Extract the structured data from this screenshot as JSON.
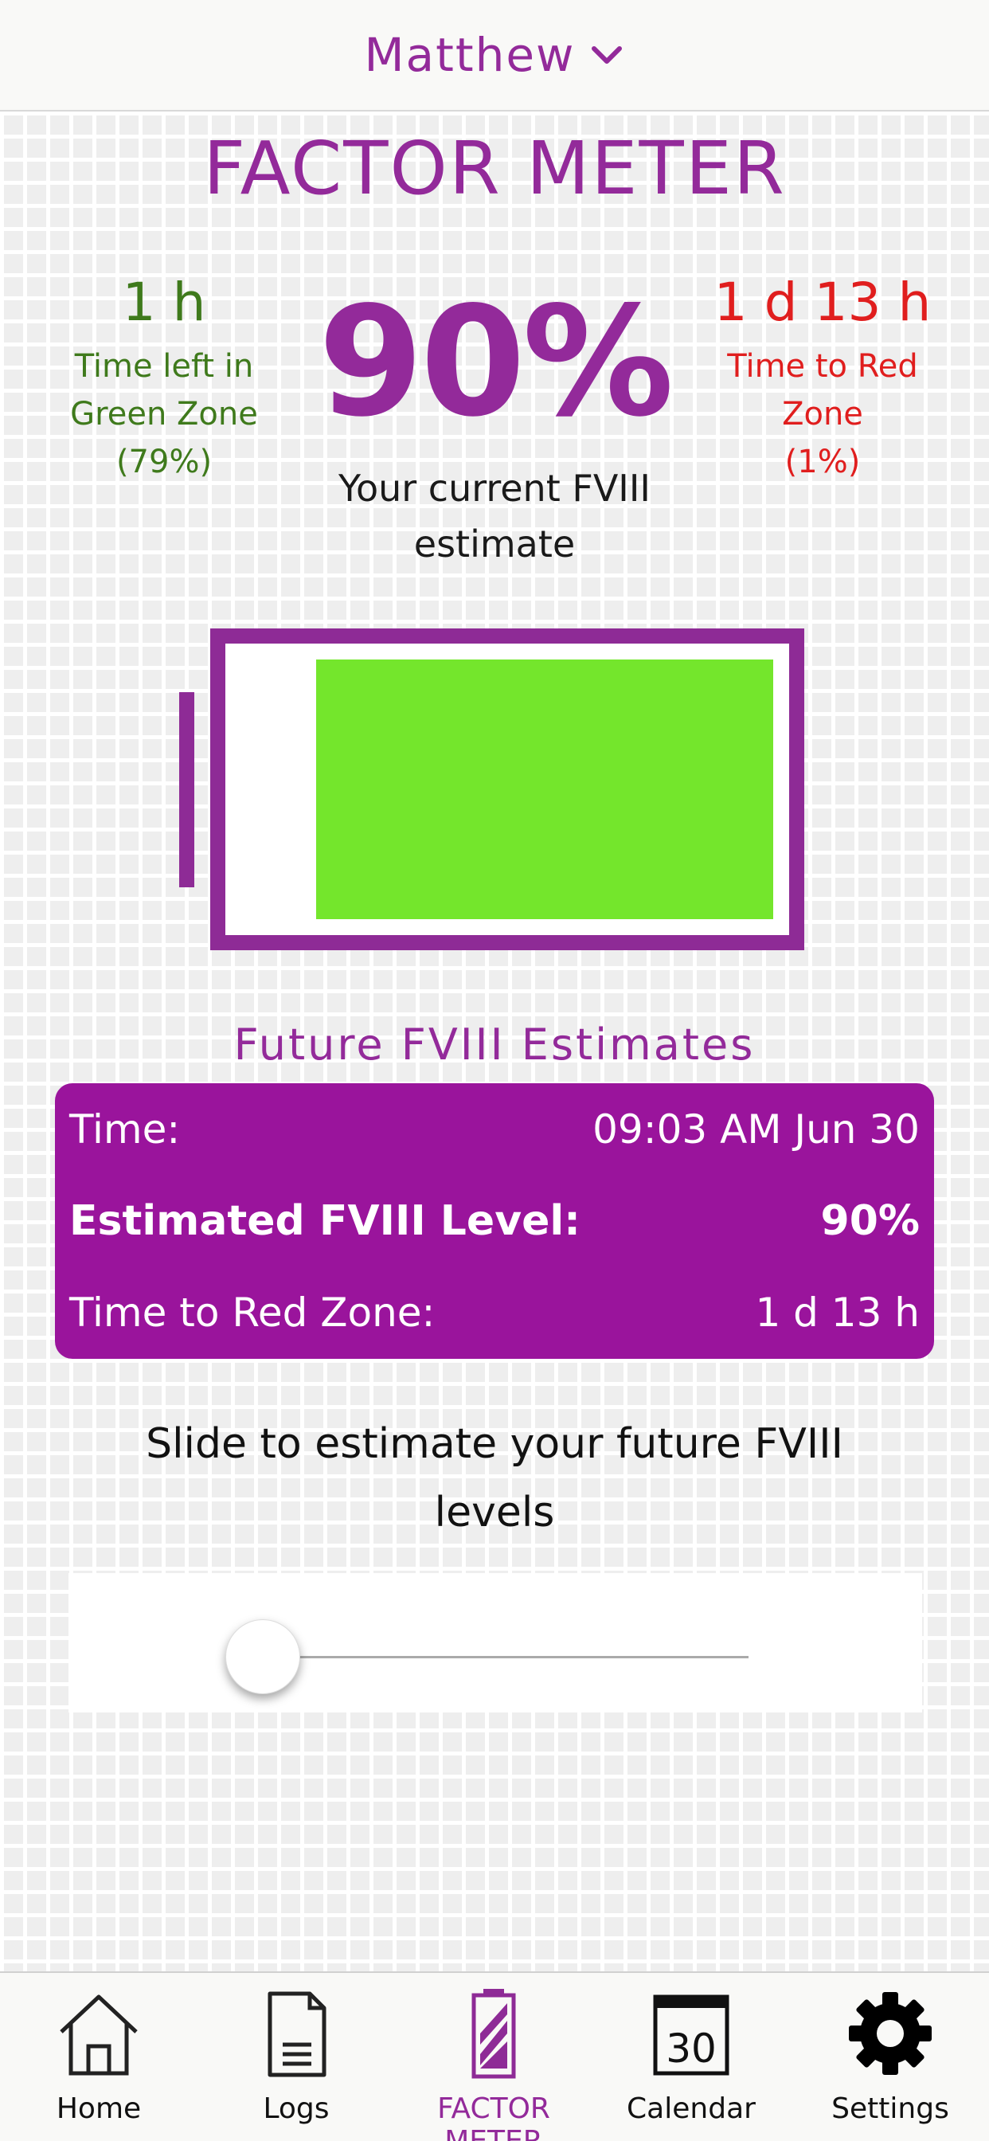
{
  "header": {
    "user_name": "Matthew"
  },
  "title": "FACTOR METER",
  "left_stat": {
    "value": "1 h",
    "line1": "Time left in",
    "line2": "Green Zone",
    "line3": "(79%)"
  },
  "center_stat": {
    "value": "90%",
    "line1": "Your current FVIII",
    "line2": "estimate"
  },
  "right_stat": {
    "value": "1 d 13 h",
    "line1": "Time to Red",
    "line2": "Zone",
    "line3": "(1%)"
  },
  "battery": {
    "level": 0.86
  },
  "future": {
    "title": "Future FVIII Estimates",
    "rows": [
      {
        "label": "Time:",
        "value": "09:03 AM Jun 30"
      },
      {
        "label": "Estimated FVIII Level:",
        "value": "90%"
      },
      {
        "label": "Time to Red Zone:",
        "value": "1 d 13 h"
      }
    ]
  },
  "slider": {
    "line1": "Slide to estimate your future FVIII",
    "line2": "levels",
    "value": 0
  },
  "nav": {
    "items": [
      {
        "label": "Home",
        "icon": "home-icon"
      },
      {
        "label": "Logs",
        "icon": "document-icon"
      },
      {
        "label": "FACTOR METER",
        "icon": "battery-icon"
      },
      {
        "label": "Calendar",
        "icon": "calendar-icon",
        "badge": "30"
      },
      {
        "label": "Settings",
        "icon": "gear-icon"
      }
    ],
    "active": 2
  },
  "colors": {
    "brand": "#932a9a",
    "green_zone": "#3f7a1c",
    "red_zone": "#e01e1e",
    "battery_fill": "#74e62c",
    "panel": "#9a149c"
  }
}
